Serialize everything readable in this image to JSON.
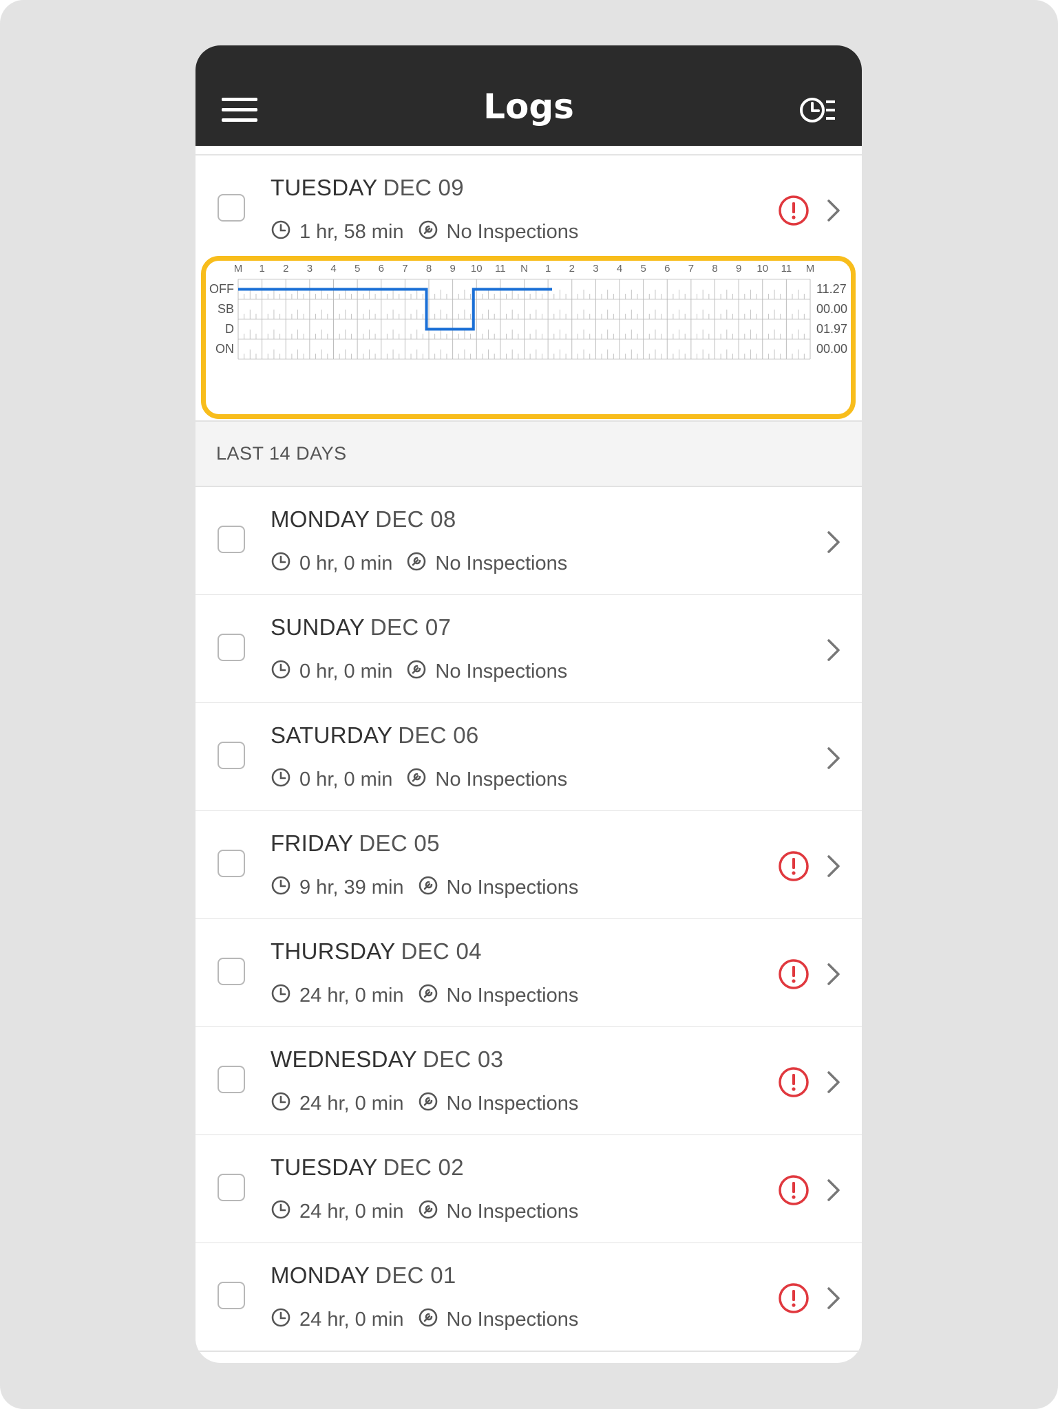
{
  "header": {
    "title": "Logs",
    "menu_icon": "hamburger-menu-icon",
    "history_icon": "clock-list-icon"
  },
  "colors": {
    "topbar": "#2b2b2b",
    "alert": "#e0383e",
    "graph_line": "#1a6fd6",
    "highlight": "#f8bd1c"
  },
  "current_day": {
    "day": "TUESDAY",
    "date": "DEC 09",
    "duration": "1 hr, 58 min",
    "inspections": "No Inspections",
    "has_alert": true
  },
  "graph": {
    "hour_labels": [
      "M",
      "1",
      "2",
      "3",
      "4",
      "5",
      "6",
      "7",
      "8",
      "9",
      "10",
      "11",
      "N",
      "1",
      "2",
      "3",
      "4",
      "5",
      "6",
      "7",
      "8",
      "9",
      "10",
      "11",
      "M"
    ],
    "status_labels": [
      "OFF",
      "SB",
      "D",
      "ON"
    ],
    "totals": [
      "11.27",
      "00.00",
      "01.97",
      "00.00"
    ],
    "segments": [
      {
        "status": "OFF",
        "start_hour": 0,
        "end_hour": 7.9
      },
      {
        "status": "D",
        "start_hour": 7.9,
        "end_hour": 9.87
      },
      {
        "status": "OFF",
        "start_hour": 9.87,
        "end_hour": 13.17
      }
    ]
  },
  "section": {
    "label": "LAST 14 DAYS"
  },
  "days": [
    {
      "day": "MONDAY",
      "date": "DEC 08",
      "duration": "0 hr, 0 min",
      "inspections": "No Inspections",
      "has_alert": false
    },
    {
      "day": "SUNDAY",
      "date": "DEC 07",
      "duration": "0 hr, 0 min",
      "inspections": "No Inspections",
      "has_alert": false
    },
    {
      "day": "SATURDAY",
      "date": "DEC 06",
      "duration": "0 hr, 0 min",
      "inspections": "No Inspections",
      "has_alert": false
    },
    {
      "day": "FRIDAY",
      "date": "DEC 05",
      "duration": "9 hr, 39 min",
      "inspections": "No Inspections",
      "has_alert": true
    },
    {
      "day": "THURSDAY",
      "date": "DEC 04",
      "duration": "24 hr, 0 min",
      "inspections": "No Inspections",
      "has_alert": true
    },
    {
      "day": "WEDNESDAY",
      "date": "DEC 03",
      "duration": "24 hr, 0 min",
      "inspections": "No Inspections",
      "has_alert": true
    },
    {
      "day": "TUESDAY",
      "date": "DEC 02",
      "duration": "24 hr, 0 min",
      "inspections": "No Inspections",
      "has_alert": true
    },
    {
      "day": "MONDAY",
      "date": "DEC 01",
      "duration": "24 hr, 0 min",
      "inspections": "No Inspections",
      "has_alert": true
    }
  ]
}
